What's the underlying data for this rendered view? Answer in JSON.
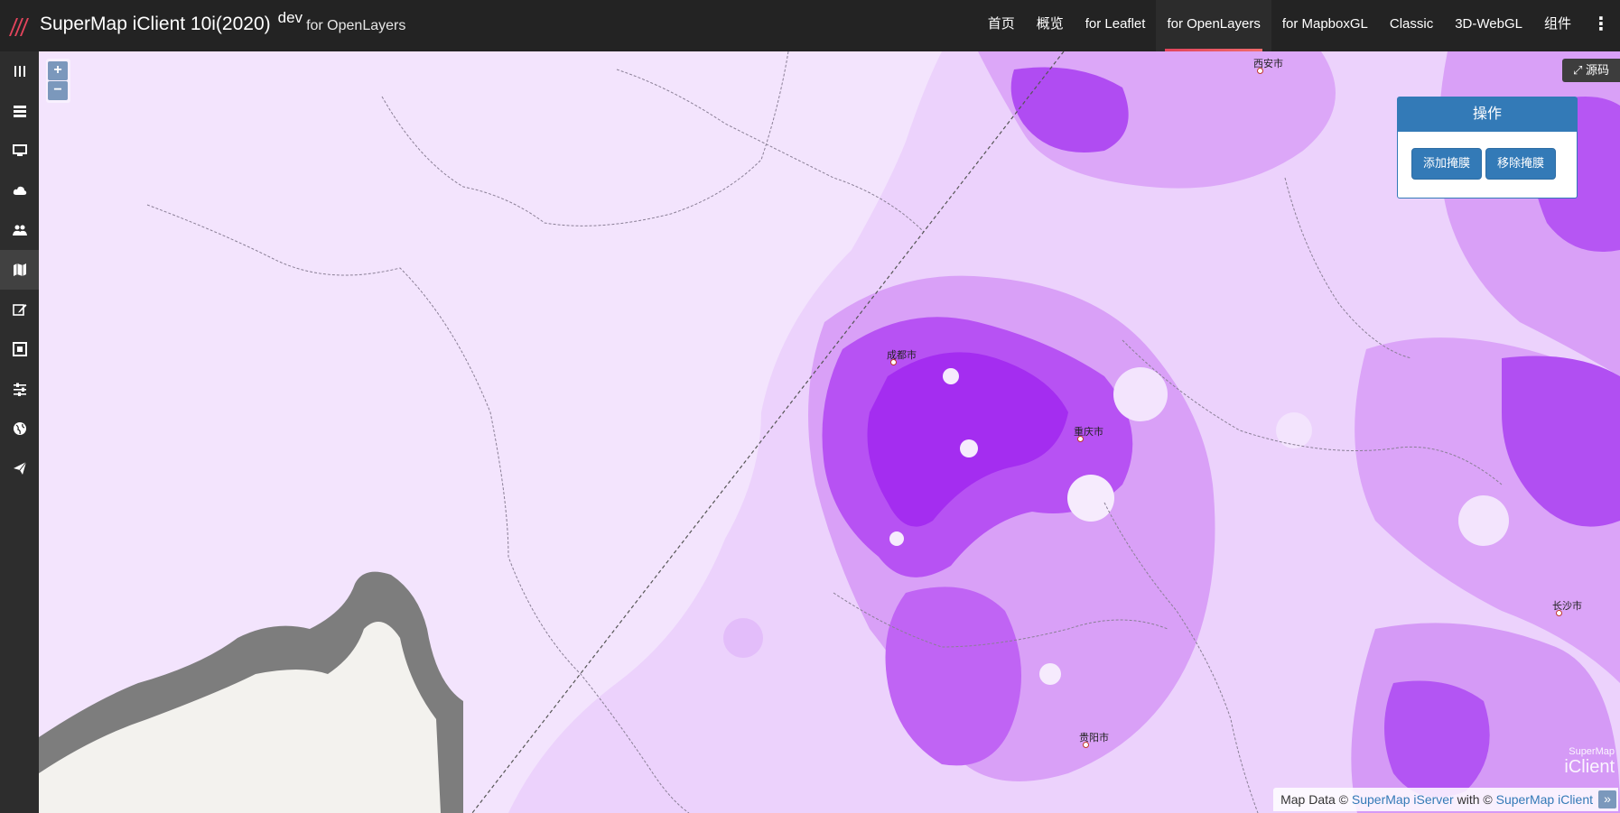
{
  "header": {
    "brand_title": "SuperMap iClient 10i(2020)",
    "brand_dev": "dev",
    "brand_sub": "for OpenLayers",
    "nav": [
      {
        "label": "首页"
      },
      {
        "label": "概览"
      },
      {
        "label": "for Leaflet"
      },
      {
        "label": "for OpenLayers",
        "active": true
      },
      {
        "label": "for MapboxGL"
      },
      {
        "label": "Classic"
      },
      {
        "label": "3D-WebGL"
      },
      {
        "label": "组件"
      }
    ],
    "accent_color": "#e2445c"
  },
  "sidebar": {
    "items": [
      {
        "icon": "columns-icon"
      },
      {
        "icon": "layer-list-icon"
      },
      {
        "icon": "desktop-icon"
      },
      {
        "icon": "cloud-icon"
      },
      {
        "icon": "users-icon"
      },
      {
        "icon": "map-icon",
        "active": true
      },
      {
        "icon": "edit-icon"
      },
      {
        "icon": "frame-icon"
      },
      {
        "icon": "sliders-icon"
      },
      {
        "icon": "globe-icon"
      },
      {
        "icon": "send-icon"
      }
    ]
  },
  "map": {
    "zoom_in": "+",
    "zoom_out": "−",
    "code_button": "源码",
    "cities": [
      {
        "name": "西安市"
      },
      {
        "name": "成都市"
      },
      {
        "name": "重庆市"
      },
      {
        "name": "长沙市"
      },
      {
        "name": "贵阳市"
      }
    ],
    "panel": {
      "title": "操作",
      "add_mask": "添加掩膜",
      "remove_mask": "移除掩膜"
    },
    "attribution": {
      "prefix": "Map Data © ",
      "link1": "SuperMap iServer",
      "middle": " with © ",
      "link2": "SuperMap iClient",
      "toggle": "»"
    },
    "watermark": {
      "line1": "SuperMap",
      "line2": "iClient"
    },
    "colors": {
      "background": "#f3e4fd",
      "purple_light": "#e6c4fb",
      "purple_mid": "#cf8bf5",
      "purple_dark": "#a42df0",
      "land": "#f3f2ee",
      "border_band": "#7d7d7d"
    }
  }
}
